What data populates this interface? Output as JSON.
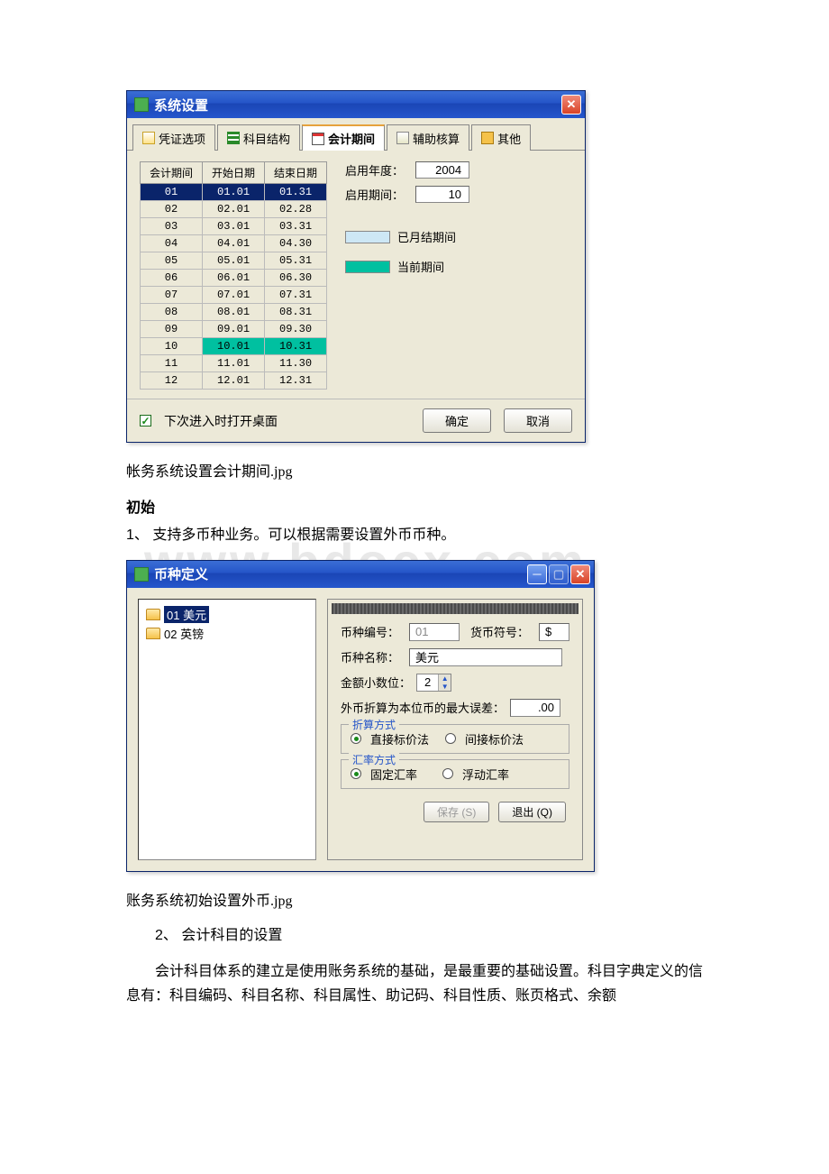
{
  "dialog1": {
    "title": "系统设置",
    "tabs": {
      "voucher": "凭证选项",
      "subject": "科目结构",
      "period": "会计期间",
      "aux": "辅助核算",
      "other": "其他"
    },
    "table": {
      "headers": {
        "period": "会计期间",
        "start": "开始日期",
        "end": "结束日期"
      },
      "rows": [
        {
          "p": "01",
          "s": "01.01",
          "e": "01.31"
        },
        {
          "p": "02",
          "s": "02.01",
          "e": "02.28"
        },
        {
          "p": "03",
          "s": "03.01",
          "e": "03.31"
        },
        {
          "p": "04",
          "s": "04.01",
          "e": "04.30"
        },
        {
          "p": "05",
          "s": "05.01",
          "e": "05.31"
        },
        {
          "p": "06",
          "s": "06.01",
          "e": "06.30"
        },
        {
          "p": "07",
          "s": "07.01",
          "e": "07.31"
        },
        {
          "p": "08",
          "s": "08.01",
          "e": "08.31"
        },
        {
          "p": "09",
          "s": "09.01",
          "e": "09.30"
        },
        {
          "p": "10",
          "s": "10.01",
          "e": "10.31"
        },
        {
          "p": "11",
          "s": "11.01",
          "e": "11.30"
        },
        {
          "p": "12",
          "s": "12.01",
          "e": "12.31"
        }
      ]
    },
    "right": {
      "yearLabel": "启用年度：",
      "yearValue": "2004",
      "periodLabel": "启用期间：",
      "periodValue": "10",
      "legendClosed": "已月结期间",
      "legendCurrent": "当前期间"
    },
    "footer": {
      "openDesktop": "下次进入时打开桌面",
      "ok": "确定",
      "cancel": "取消"
    }
  },
  "caption1": "帐务系统设置会计期间.jpg",
  "heading1": "初始",
  "para1": "1、 支持多币种业务。可以根据需要设置外币币种。",
  "dialog2": {
    "title": "币种定义",
    "tree": {
      "item1": "01  美元",
      "item2": "02  英镑"
    },
    "form": {
      "codeLabel": "币种编号：",
      "codeValue": "01",
      "symLabel": "货币符号：",
      "symValue": "$",
      "nameLabel": "币种名称：",
      "nameValue": "美元",
      "decLabel": "金额小数位：",
      "decValue": "2",
      "errLabel": "外币折算为本位币的最大误差：",
      "errValue": ".00",
      "grp1Title": "折算方式",
      "grp1Opt1": "直接标价法",
      "grp1Opt2": "间接标价法",
      "grp2Title": "汇率方式",
      "grp2Opt1": "固定汇率",
      "grp2Opt2": "浮动汇率",
      "save": "保存 (S)",
      "exit": "退出 (Q)"
    }
  },
  "caption2": "账务系统初始设置外币.jpg",
  "para2": "2、 会计科目的设置",
  "para3": "会计科目体系的建立是使用账务系统的基础，是最重要的基础设置。科目字典定义的信息有：科目编码、科目名称、科目属性、助记码、科目性质、账页格式、余额"
}
